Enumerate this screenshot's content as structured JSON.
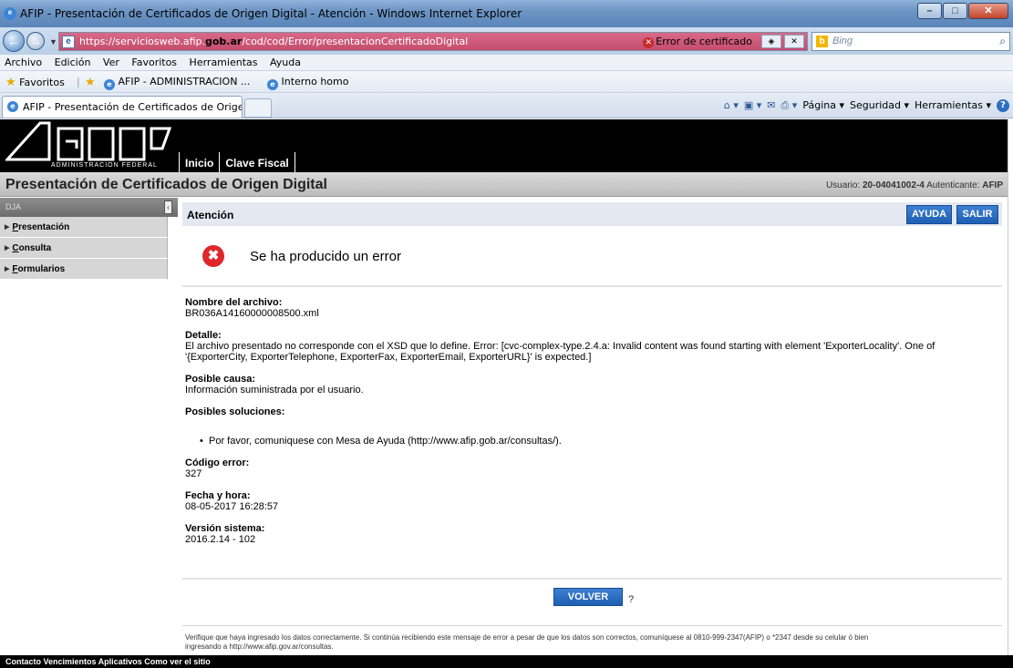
{
  "window": {
    "title": "AFIP - Presentación de Certificados de Origen Digital - Atención - Windows Internet Explorer",
    "url_prefix": "https://serviciosweb.afip.",
    "url_domain": "gob.ar",
    "url_suffix": "/cod/cod/Error/presentacionCertificadoDigital",
    "cert_error": "Error de certificado",
    "search_placeholder": "Bing"
  },
  "menu": [
    "Archivo",
    "Edición",
    "Ver",
    "Favoritos",
    "Herramientas",
    "Ayuda"
  ],
  "favorites": {
    "label": "Favoritos",
    "item1": "AFIP - ADMINISTRACION ...",
    "item2": "Interno homo"
  },
  "tab": {
    "label": "AFIP - Presentación de Certificados de Origen Di...",
    "cmd_page": "Página",
    "cmd_security": "Seguridad",
    "cmd_tools": "Herramientas"
  },
  "header": {
    "logo_sub": "ADMINISTRACION FEDERAL",
    "nav": [
      "Inicio",
      "Clave Fiscal"
    ]
  },
  "app": {
    "title": "Presentación de Certificados de Origen Digital",
    "user_label": "Usuario:",
    "user_value": "20-04041002-4",
    "auth_label": "Autenticante:",
    "auth_value": "AFIP"
  },
  "sidebar": {
    "head": "DJA",
    "items": [
      {
        "first": "P",
        "rest": "resentación"
      },
      {
        "first": "C",
        "rest": "onsulta"
      },
      {
        "first": "F",
        "rest": "ormularios"
      }
    ]
  },
  "panel": {
    "title": "Atención",
    "help_btn": "AYUDA",
    "exit_btn": "SALIR",
    "error_title": "Se ha producido un error",
    "file_label": "Nombre del archivo:",
    "file_value": "BR036A14160000008500.xml",
    "detail_label": "Detalle:",
    "detail_value": "El archivo presentado no corresponde con el XSD que lo define. Error: [cvc-complex-type.2.4.a: Invalid content was found starting with element 'ExporterLocality'. One of '{ExporterCity, ExporterTelephone, ExporterFax, ExporterEmail, ExporterURL}' is expected.]",
    "cause_label": "Posible causa:",
    "cause_value": "Información suministrada por el usuario.",
    "solutions_label": "Posibles soluciones:",
    "solution_item": "Por favor, comuniquese con Mesa de Ayuda (http://www.afip.gob.ar/consultas/).",
    "code_label": "Código error:",
    "code_value": "327",
    "date_label": "Fecha y hora:",
    "date_value": "08-05-2017 16:28:57",
    "version_label": "Versión sistema:",
    "version_value": "2016.2.14 - 102",
    "back_btn": "VOLVER",
    "question": "?",
    "footnote_line1": "Verifique que haya ingresado los datos correctamente. Si continúa recibiendo este mensaje de error a pesar de que los datos son correctos, comuníquese al 0810-999-2347(AFIP) o *2347 desde su celular ó bien",
    "footnote_line2_prefix": "ingresando a ",
    "footnote_link": "http://www.afip.gov.ar/consultas."
  },
  "bottombar": "Contacto  Vencimientos  Aplicativos  Como ver el sitio"
}
